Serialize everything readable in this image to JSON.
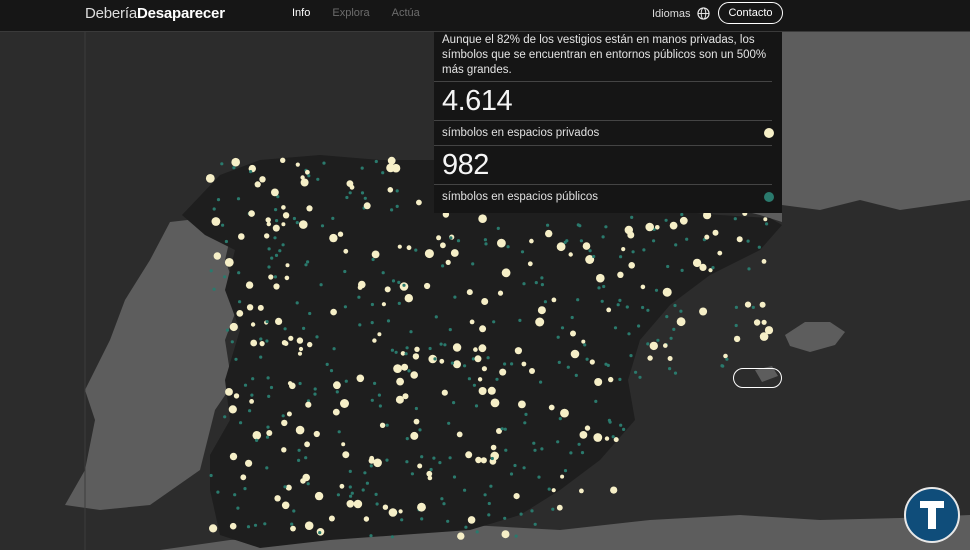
{
  "brand": {
    "light": "Debería",
    "bold": "Desaparecer"
  },
  "nav": {
    "items": [
      {
        "label": "Info",
        "active": true
      },
      {
        "label": "Explora",
        "active": false
      },
      {
        "label": "Actúa",
        "active": false
      }
    ]
  },
  "lang": {
    "label": "Idiomas"
  },
  "contact": {
    "label": "Contacto"
  },
  "stats": {
    "intro": "Aunque el 82% de los vestigios están en manos privadas, los símbolos que se encuentran en entornos públicos son un 500% más grandes.",
    "private": {
      "value": "4.614",
      "label": "símbolos en espacios privados",
      "color": "#f6efc7"
    },
    "public": {
      "value": "982",
      "label": "símbolos en espacios públicos",
      "color": "#2a7a6d"
    }
  },
  "colors": {
    "sea": "#2c2c2c",
    "land": "#5d5d5d",
    "spain": "#1e1e1e",
    "private": "#f6efc7",
    "public": "#2a7a6d",
    "logo": "#0f4d7a"
  },
  "icons": {
    "globe": "globe-icon",
    "logo": "logo-t-icon"
  }
}
